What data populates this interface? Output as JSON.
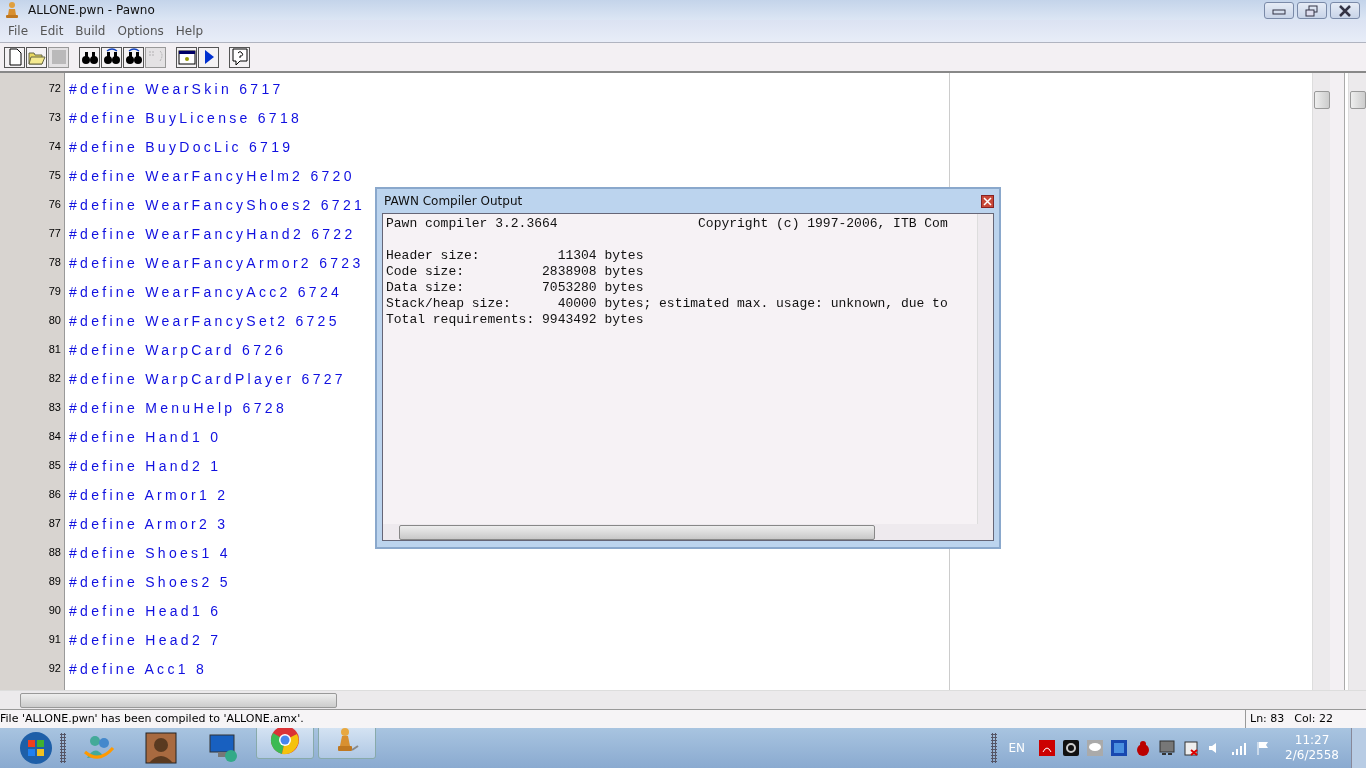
{
  "window": {
    "title": "ALLONE.pwn - Pawno"
  },
  "menu": [
    "File",
    "Edit",
    "Build",
    "Options",
    "Help"
  ],
  "toolbar": [
    {
      "kind": "new",
      "disabled": false
    },
    {
      "kind": "open",
      "disabled": false
    },
    {
      "kind": "save",
      "disabled": true
    },
    {
      "kind": "separator"
    },
    {
      "kind": "find",
      "disabled": false
    },
    {
      "kind": "find-next",
      "disabled": false
    },
    {
      "kind": "replace",
      "disabled": false
    },
    {
      "kind": "goto",
      "disabled": true
    },
    {
      "kind": "separator"
    },
    {
      "kind": "compile",
      "disabled": false
    },
    {
      "kind": "run",
      "disabled": false
    },
    {
      "kind": "separator"
    },
    {
      "kind": "help",
      "disabled": false
    }
  ],
  "editor": {
    "lines": [
      {
        "number": "72",
        "code": "#define WearSkin 6717"
      },
      {
        "number": "73",
        "code": "#define BuyLicense 6718"
      },
      {
        "number": "74",
        "code": "#define BuyDocLic 6719"
      },
      {
        "number": "75",
        "code": "#define WearFancyHelm2 6720"
      },
      {
        "number": "76",
        "code": "#define WearFancyShoes2 6721"
      },
      {
        "number": "77",
        "code": "#define WearFancyHand2 6722"
      },
      {
        "number": "78",
        "code": "#define WearFancyArmor2 6723"
      },
      {
        "number": "79",
        "code": "#define WearFancyAcc2 6724"
      },
      {
        "number": "80",
        "code": "#define WearFancySet2 6725"
      },
      {
        "number": "81",
        "code": "#define WarpCard 6726"
      },
      {
        "number": "82",
        "code": "#define WarpCardPlayer 6727"
      },
      {
        "number": "83",
        "code": "#define MenuHelp 6728"
      },
      {
        "number": "84",
        "code": "#define Hand1 0"
      },
      {
        "number": "85",
        "code": "#define Hand2 1"
      },
      {
        "number": "86",
        "code": "#define Armor1 2"
      },
      {
        "number": "87",
        "code": "#define Armor2 3"
      },
      {
        "number": "88",
        "code": "#define Shoes1 4"
      },
      {
        "number": "89",
        "code": "#define Shoes2 5"
      },
      {
        "number": "90",
        "code": "#define Head1 6"
      },
      {
        "number": "91",
        "code": "#define Head2 7"
      },
      {
        "number": "92",
        "code": "#define Acc1 8"
      }
    ]
  },
  "dialog": {
    "title": "PAWN Compiler Output",
    "header_line": "Pawn compiler 3.2.3664                  Copyright (c) 1997-2006, ITB Com",
    "lines": [
      "Header size:          11304 bytes",
      "Code size:          2838908 bytes",
      "Data size:          7053280 bytes",
      "Stack/heap size:      40000 bytes; estimated max. usage: unknown, due to",
      "Total requirements: 9943492 bytes"
    ]
  },
  "status_bar": {
    "message": "File 'ALLONE.pwn' has been compiled to 'ALLONE.amx'.",
    "line": "Ln: 83",
    "column": "Col: 22"
  },
  "taskbar": {
    "apps": [
      {
        "kind": "messenger",
        "highlighted": false
      },
      {
        "kind": "avatar",
        "highlighted": false
      },
      {
        "kind": "remote",
        "highlighted": false
      },
      {
        "kind": "browser",
        "highlighted": true
      },
      {
        "kind": "pawn",
        "highlighted": true
      }
    ],
    "language": "EN",
    "time": "11:27",
    "date": "2/6/2558"
  }
}
